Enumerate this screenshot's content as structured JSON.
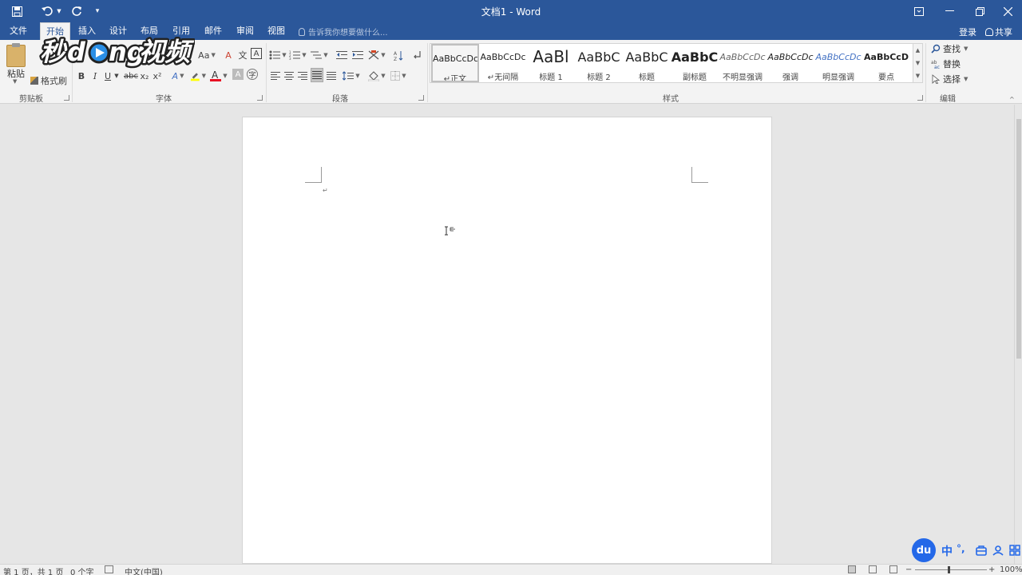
{
  "window": {
    "title": "文档1 - Word",
    "login_label": "登录",
    "share_label": "共享"
  },
  "tabs": [
    {
      "label": "文件",
      "active": false
    },
    {
      "label": "开始",
      "active": true
    },
    {
      "label": "插入",
      "active": false
    },
    {
      "label": "设计",
      "active": false
    },
    {
      "label": "布局",
      "active": false
    },
    {
      "label": "引用",
      "active": false
    },
    {
      "label": "邮件",
      "active": false
    },
    {
      "label": "审阅",
      "active": false
    },
    {
      "label": "视图",
      "active": false
    }
  ],
  "tell_me": {
    "placeholder": "告诉我你想要做什么..."
  },
  "clipboard": {
    "group_label": "剪贴板",
    "paste_label": "粘贴",
    "format_painter_label": "格式刷"
  },
  "font": {
    "group_label": "字体",
    "change_case_label": "Aa",
    "bold": "B",
    "italic": "I",
    "underline": "U",
    "strike": "abc",
    "subscript": "x₂",
    "superscript": "x²",
    "font_color": "#e81123",
    "highlight_color": "#ffff00"
  },
  "paragraph": {
    "group_label": "段落"
  },
  "styles": {
    "group_label": "样式",
    "items": [
      {
        "sample": "AaBbCcDc",
        "name": "正文",
        "selected": true,
        "mark": "↵"
      },
      {
        "sample": "AaBbCcDc",
        "name": "无间隔",
        "selected": false,
        "mark": "↵"
      },
      {
        "sample": "AaBl",
        "name": "标题 1",
        "selected": false
      },
      {
        "sample": "AaBbC",
        "name": "标题 2",
        "selected": false
      },
      {
        "sample": "AaBbC",
        "name": "标题",
        "selected": false
      },
      {
        "sample": "AaBbC",
        "name": "副标题",
        "selected": false
      },
      {
        "sample": "AaBbCcDc",
        "name": "不明显强调",
        "selected": false
      },
      {
        "sample": "AaBbCcDc",
        "name": "强调",
        "selected": false
      },
      {
        "sample": "AaBbCcDc",
        "name": "明显强调",
        "selected": false
      },
      {
        "sample": "AaBbCcD",
        "name": "要点",
        "selected": false
      }
    ]
  },
  "editing": {
    "group_label": "编辑",
    "find_label": "查找",
    "replace_label": "替换",
    "select_label": "选择"
  },
  "document": {
    "paragraph_mark": "↵"
  },
  "status": {
    "page": "第 1 页，共 1 页",
    "words": "0 个字",
    "language": "中文(中国)",
    "zoom": "100%"
  },
  "ime_toolbar": {
    "logo": "du",
    "mode": "中",
    "punct": "°,"
  }
}
